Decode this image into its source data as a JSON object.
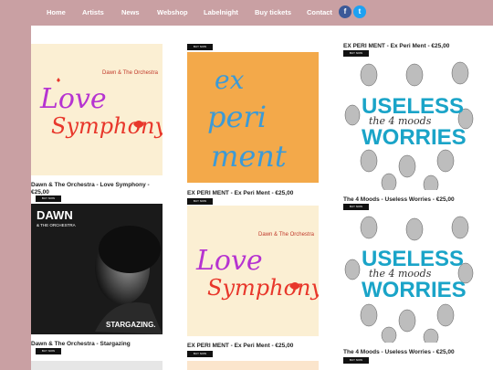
{
  "nav": {
    "items": [
      "Home",
      "Artists",
      "News",
      "Webshop",
      "Labelnight",
      "Buy tickets",
      "Contact"
    ],
    "facebook_glyph": "f",
    "twitter_glyph": "t",
    "facebook_color": "#3b5998",
    "twitter_color": "#1da1f2"
  },
  "products": {
    "love_symphony": {
      "caption": "Dawn & The Orchestra - Love Symphony - €25,00",
      "art_artist": "Dawn & The Orchestra",
      "art_line1": "Love",
      "art_line2": "Symphony"
    },
    "stargazing": {
      "caption": "Dawn & The Orchestra - Stargazing",
      "art_name": "DAWN",
      "art_sub": "& THE ORCHESTRA",
      "art_title": "STARGAZING."
    },
    "ex_peri_ment": {
      "caption": "EX PERI MENT - Ex Peri Ment - €25,00",
      "art_line1": "ex",
      "art_line2": "peri",
      "art_line3": "ment"
    },
    "ex_peri_ment_2": {
      "caption": "EX PERI MENT - Ex Peri Ment - €25,00"
    },
    "love_symphony_2": {
      "art_artist": "Dawn & The Orchestra",
      "art_line1": "Love",
      "art_line2": "Symphony"
    },
    "ex_peri_ment_top": {
      "caption": "EX PERI MENT - Ex Peri Ment - €25,00"
    },
    "useless_worries": {
      "caption": "The 4 Moods - Useless Worries - €25,00",
      "art_line1": "USELESS",
      "art_line2": "WORRIES",
      "art_script": "the 4 moods"
    },
    "useless_worries_2": {
      "caption": "The 4 Moods - Useless Worries - €25,00"
    }
  },
  "buy_label": "BUY NOW"
}
